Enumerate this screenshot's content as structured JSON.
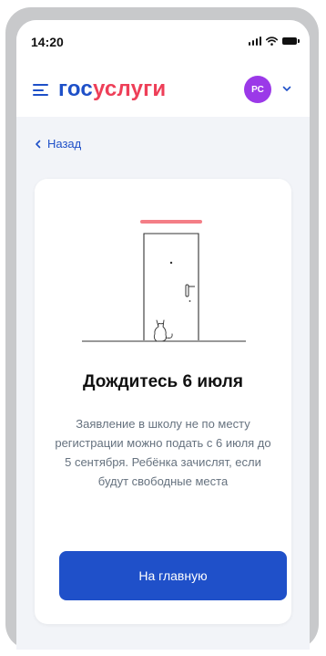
{
  "status_bar": {
    "time": "14:20"
  },
  "header": {
    "logo_part1": "гос",
    "logo_part2": "услуги",
    "avatar_initials": "РС"
  },
  "nav": {
    "back_label": "Назад"
  },
  "card": {
    "title": "Дождитесь 6 июля",
    "text": "Заявление в школу не по месту регистрации можно подать с 6 июля до 5 сентября. Ребёнка зачислят, если будут свободные места",
    "button_label": "На главную"
  },
  "colors": {
    "brand_blue": "#1e50c8",
    "brand_red": "#ee3f58",
    "avatar": "#9b39e8",
    "button": "#1f50c9",
    "background": "#f2f4f8",
    "muted_text": "#66727f"
  },
  "icons": {
    "menu": "menu-icon",
    "chevron_down": "chevron-down-icon",
    "back": "chevron-left-icon",
    "signal": "signal-icon",
    "wifi": "wifi-icon",
    "battery": "battery-icon"
  }
}
